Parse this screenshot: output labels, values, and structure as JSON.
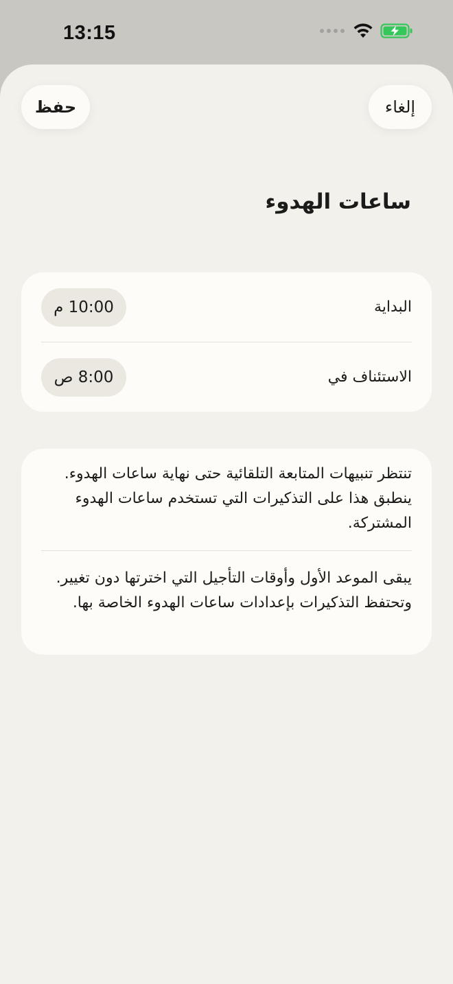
{
  "status_bar": {
    "time": "13:15",
    "icons": [
      "signal-dots-icon",
      "wifi-icon",
      "battery-charging-icon"
    ],
    "battery_color": "#34c759"
  },
  "header": {
    "cancel_label": "إلغاء",
    "save_label": "حفظ"
  },
  "title": "ساعات الهدوء",
  "quiet_hours": {
    "start_label": "البداية",
    "start_time": "10:00 م",
    "resume_label": "الاستئناف في",
    "resume_time": "8:00 ص"
  },
  "info": {
    "paragraph1": "تنتظر تنبيهات المتابعة التلقائية حتى نهاية ساعات الهدوء. ينطبق هذا على التذكيرات التي تستخدم ساعات الهدوء المشتركة.",
    "paragraph2": "يبقى الموعد الأول وأوقات التأجيل التي اخترتها دون تغيير. وتحتفظ التذكيرات بإعدادات ساعات الهدوء الخاصة بها."
  },
  "colors": {
    "sheet_background": "#f3f1ec",
    "card_background": "#fdfcf8",
    "pill_background": "#ebe8e2"
  }
}
